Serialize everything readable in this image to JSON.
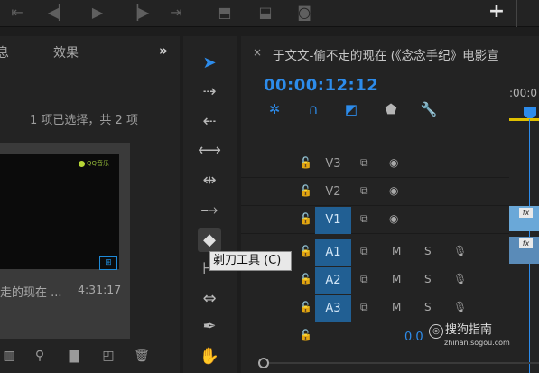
{
  "project": {
    "tabs": [
      "息",
      "效果"
    ],
    "more": "»",
    "selection_info": "1 项已选择，共 2 项",
    "clip": {
      "logo": "QQ音乐",
      "badge": "⊞",
      "name": "走的现在 ...",
      "duration": "4:31:17"
    }
  },
  "tools": {
    "tooltip": "剃刀工具 (C)"
  },
  "timeline": {
    "close": "×",
    "title": "于文文-偷不走的现在 (《念念手纪》电影宣",
    "timecode": "00:00:12:12",
    "ruler": ":00:0",
    "tracks": [
      {
        "name": "V3",
        "on": false,
        "type": "video"
      },
      {
        "name": "V2",
        "on": false,
        "type": "video"
      },
      {
        "name": "V1",
        "on": true,
        "type": "video"
      },
      {
        "name": "A1",
        "on": true,
        "type": "audio"
      },
      {
        "name": "A2",
        "on": true,
        "type": "audio"
      },
      {
        "name": "A3",
        "on": true,
        "type": "audio"
      }
    ],
    "audio_m": "M",
    "audio_s": "S",
    "master_value": "0.0",
    "fx_label": "fx"
  },
  "watermark": {
    "main": "搜狗指南",
    "sub": "zhinan.sogou.com"
  },
  "icons": [
    "go-to-in-icon",
    "step-back-icon",
    "play-icon",
    "step-forward-icon",
    "go-to-out-icon",
    "lift-icon",
    "extract-icon",
    "camera-icon",
    "plus-icon"
  ]
}
